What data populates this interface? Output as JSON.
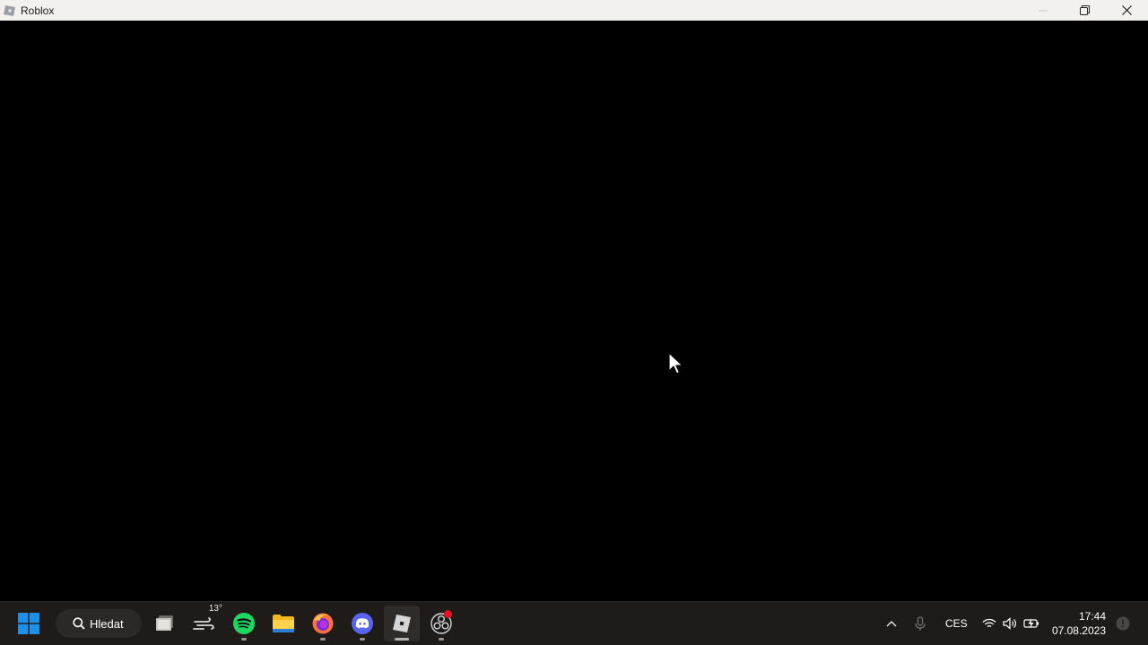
{
  "window": {
    "title": "Roblox",
    "icon": "roblox-icon",
    "controls": [
      "minimize-icon",
      "restore-icon",
      "close-icon"
    ]
  },
  "taskbar": {
    "search_label": "Hledat",
    "weather_temp": "13°",
    "apps": [
      {
        "name": "task-view",
        "icon": "task-view-icon"
      },
      {
        "name": "weather",
        "icon": "weather-icon"
      },
      {
        "name": "spotify",
        "icon": "spotify-icon"
      },
      {
        "name": "file-explorer",
        "icon": "folder-icon"
      },
      {
        "name": "firefox",
        "icon": "firefox-icon"
      },
      {
        "name": "discord",
        "icon": "discord-icon"
      },
      {
        "name": "roblox",
        "icon": "roblox-icon"
      },
      {
        "name": "obs",
        "icon": "obs-icon"
      }
    ],
    "tray": {
      "language": "CES",
      "time": "17:44",
      "date": "07.08.2023"
    }
  },
  "colors": {
    "titlebar": "#f3f1ee",
    "taskbar": "#1e1b19",
    "viewport": "#000000",
    "windows_blue": "#1e90e8",
    "spotify_green": "#1ed760",
    "discord_blurple": "#5865f2"
  }
}
